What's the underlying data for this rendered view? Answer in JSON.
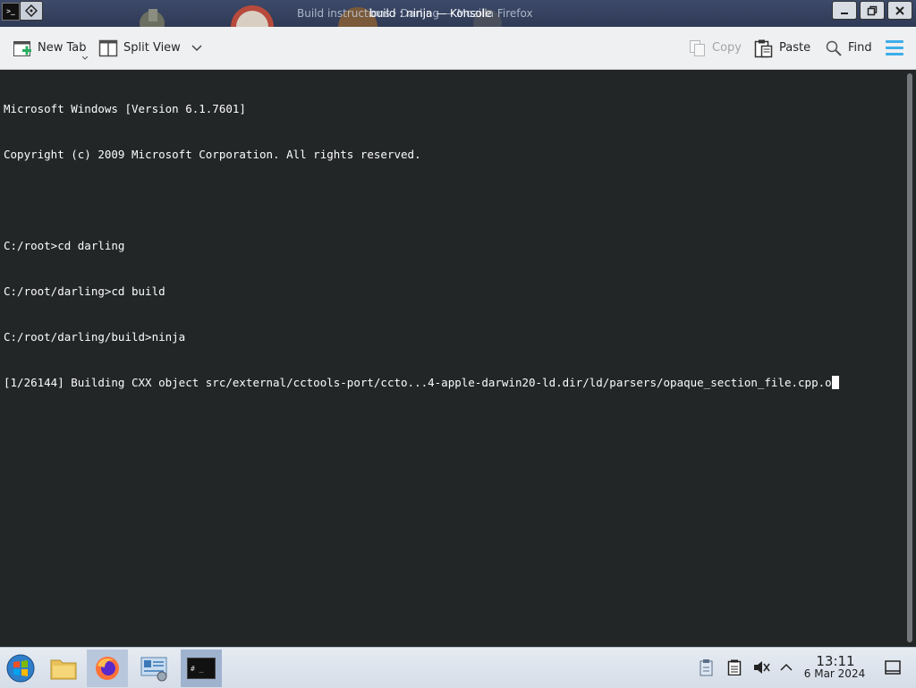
{
  "titlebar": {
    "background_title": "Build instructions · Darling — Mozilla Firefox",
    "title": "build : ninja — Konsole",
    "app_icon_text": ">_"
  },
  "toolbar": {
    "new_tab": "New Tab",
    "split_view": "Split View",
    "copy": "Copy",
    "paste": "Paste",
    "find": "Find"
  },
  "terminal": {
    "lines": [
      "Microsoft Windows [Version 6.1.7601]",
      "Copyright (c) 2009 Microsoft Corporation. All rights reserved.",
      "",
      "C:/root>cd darling",
      "C:/root/darling>cd build",
      "C:/root/darling/build>ninja",
      "[1/26144] Building CXX object src/external/cctools-port/ccto...4-apple-darwin20-ld.dir/ld/parsers/opaque_section_file.cpp.o"
    ]
  },
  "taskbar": {
    "items": [
      "start-orb",
      "file-manager",
      "firefox",
      "system-settings",
      "konsole"
    ],
    "konsole_icon_text": "# _"
  },
  "clock": {
    "time": "13:11",
    "date": "6 Mar 2024"
  },
  "colors": {
    "terminal_bg": "#232627",
    "terminal_fg": "#fcfcfc",
    "toolbar_bg": "#eff0f1",
    "accent": "#3daee9",
    "taskbar_active": "#9fb3cf"
  }
}
